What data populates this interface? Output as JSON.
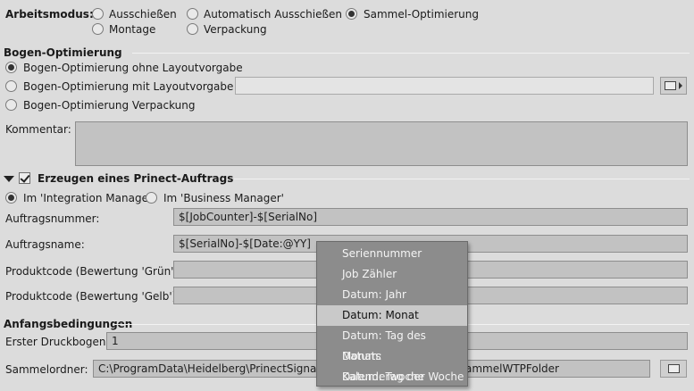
{
  "arbeitsmodus": {
    "label": "Arbeitsmodus:",
    "options": [
      "Ausschießen",
      "Automatisch Ausschießen",
      "Sammel-Optimierung",
      "Montage",
      "Verpackung"
    ],
    "selected": "Sammel-Optimierung"
  },
  "bogen": {
    "title": "Bogen-Optimierung",
    "options": [
      "Bogen-Optimierung ohne Layoutvorgabe",
      "Bogen-Optimierung mit Layoutvorgabe",
      "Bogen-Optimierung Verpackung"
    ],
    "selected": "Bogen-Optimierung ohne Layoutvorgabe",
    "layout_path": "",
    "kommentar_label": "Kommentar:",
    "kommentar_value": ""
  },
  "prinect": {
    "title": "Erzeugen eines Prinect-Auftrags",
    "enabled": true,
    "target_options": [
      "Im 'Integration Manager'",
      "Im 'Business Manager'"
    ],
    "target_selected": "Im 'Integration Manager'",
    "fields": [
      {
        "label": "Auftragsnummer:",
        "value": "$[JobCounter]-$[SerialNo]"
      },
      {
        "label": "Auftragsname:",
        "value": "$[SerialNo]-$[Date:@YY]"
      },
      {
        "label": "Produktcode (Bewertung 'Grün'):",
        "value": ""
      },
      {
        "label": "Produktcode (Bewertung 'Gelb'):",
        "value": ""
      }
    ]
  },
  "anfang": {
    "title": "Anfangsbedingungen",
    "erster_label": "Erster Druckbogen:",
    "erster_value": "1",
    "sammel_label": "Sammelordner:",
    "sammel_value_left": "C:\\ProgramData\\Heidelberg\\PrinectSignaSta",
    "sammel_value_right": "ammelWTPFolder"
  },
  "popup_menu": {
    "items": [
      "Seriennummer",
      "Job Zähler",
      "Datum: Jahr",
      "Datum: Monat",
      "Datum: Tag des Monats",
      "Datum: Kalenderwoche",
      "Datum: Tag der Woche"
    ],
    "highlighted": "Datum: Monat"
  }
}
